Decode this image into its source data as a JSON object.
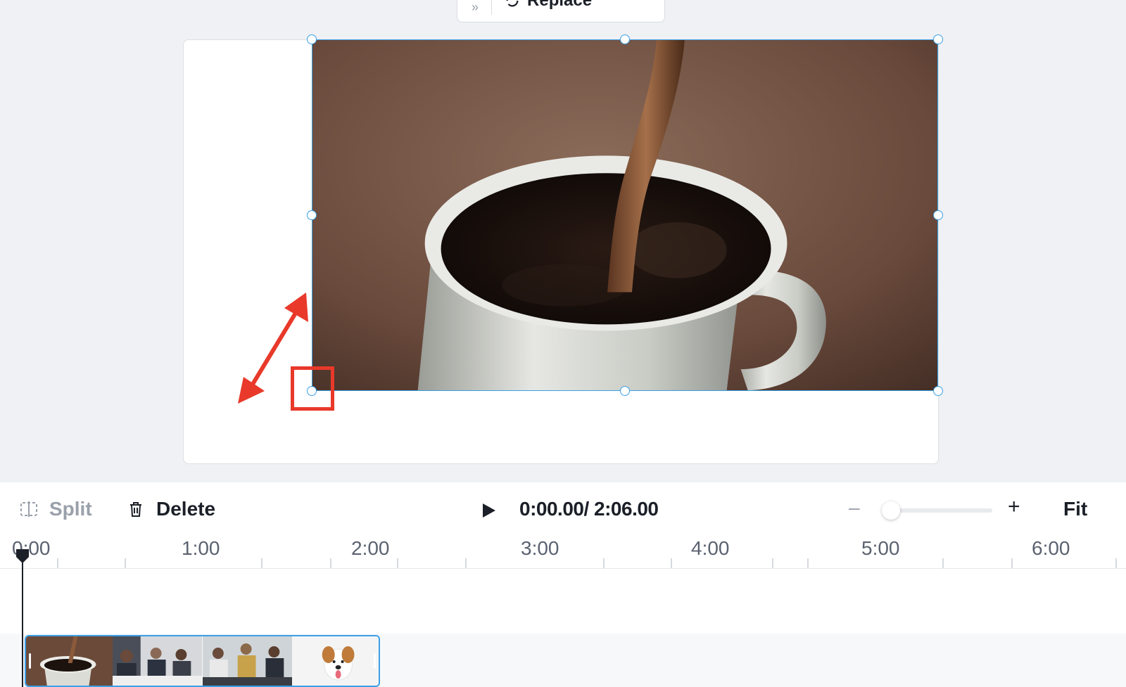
{
  "toolbar": {
    "replace_label": "Replace",
    "icons": [
      "reorder-icon",
      "replace-icon"
    ]
  },
  "canvas": {
    "selected_media": "coffee-cup-video",
    "annotation_color": "#e8392a",
    "selection_color": "#3b9fe6"
  },
  "editor": {
    "split_label": "Split",
    "delete_label": "Delete",
    "time": "0:00.00/ 2:06.00",
    "fit_label": "Fit",
    "zoom_minus": "–",
    "zoom_plus": "+",
    "zoom_level": 0.08
  },
  "ruler": {
    "labels": [
      "0:00",
      "1:00",
      "2:00",
      "3:00",
      "4:00",
      "5:00",
      "6:00"
    ]
  },
  "timeline": {
    "clip_thumbnails": [
      "coffee-cup",
      "business-meeting",
      "office-team",
      "puppy"
    ]
  }
}
